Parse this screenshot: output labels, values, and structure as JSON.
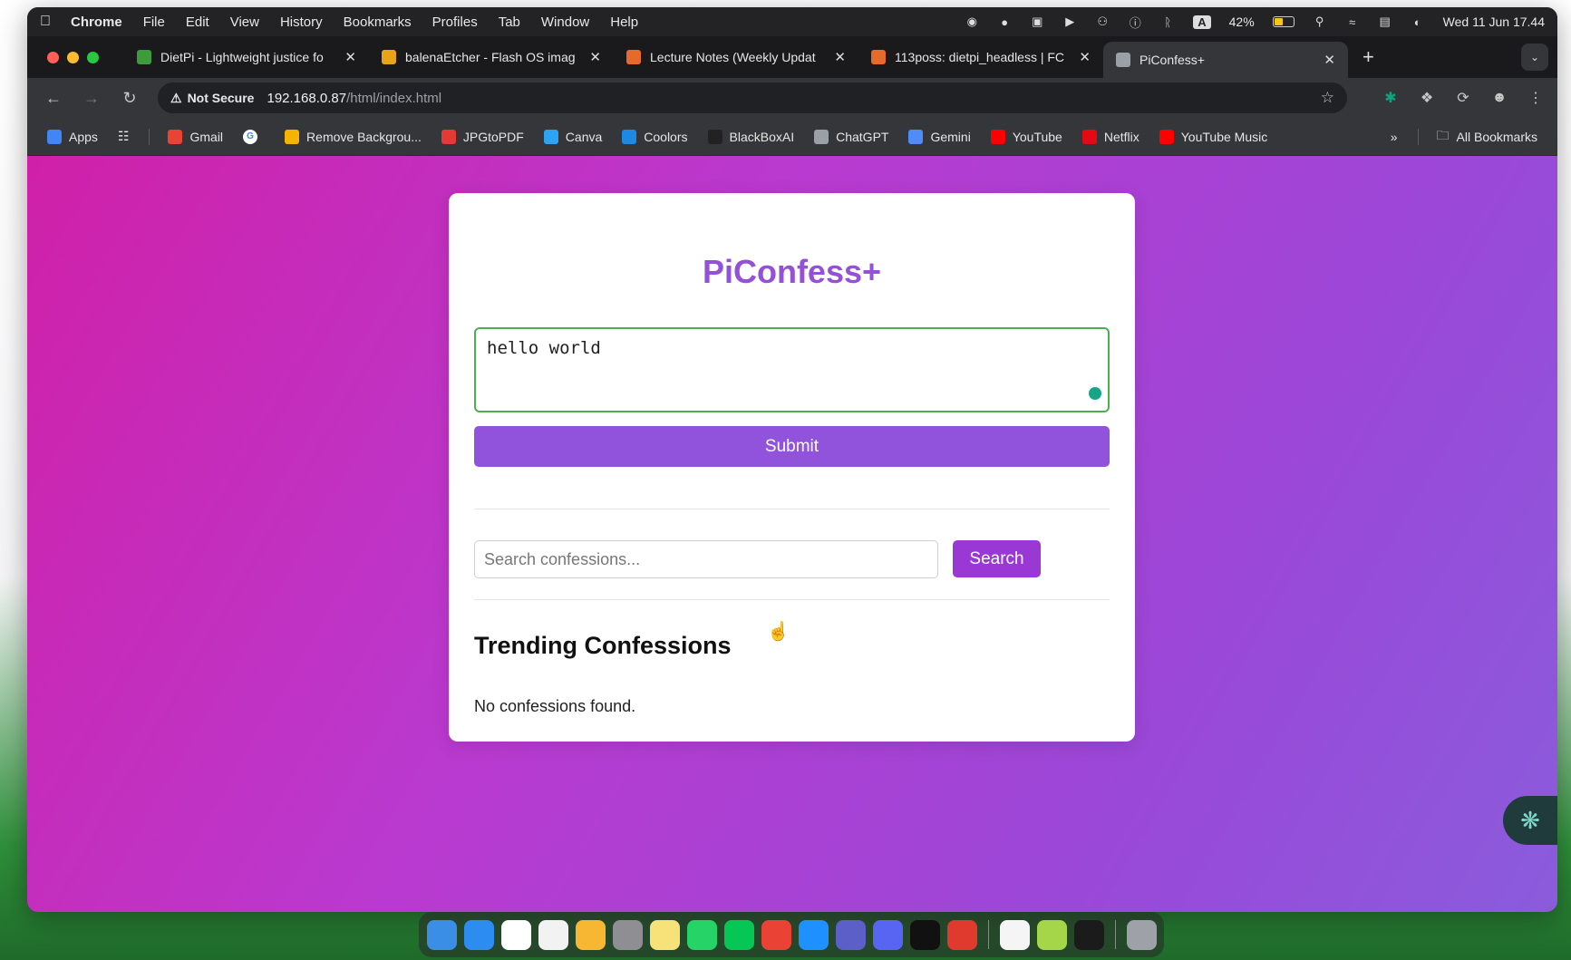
{
  "menubar": {
    "items": [
      "Chrome",
      "File",
      "Edit",
      "View",
      "History",
      "Bookmarks",
      "Profiles",
      "Tab",
      "Window",
      "Help"
    ],
    "status_a": "A",
    "battery_percent": "42%",
    "battery_level": 0.42,
    "clock": "Wed 11 Jun 17.44"
  },
  "tabs": [
    {
      "title": "DietPi - Lightweight justice fo",
      "favicon_color": "#3d9b3d"
    },
    {
      "title": "balenaEtcher - Flash OS imag",
      "favicon_color": "#e8a317"
    },
    {
      "title": "Lecture Notes (Weekly Updat",
      "favicon_color": "#e86a2b"
    },
    {
      "title": "113poss: dietpi_headless | FC",
      "favicon_color": "#e86a2b"
    },
    {
      "title": "PiConfess+",
      "favicon_color": "#9aa0a6",
      "active": true
    }
  ],
  "address": {
    "security": "Not Secure",
    "host": "192.168.0.87",
    "path": "/html/index.html"
  },
  "bookmarks": {
    "items": [
      {
        "label": "Apps",
        "color": "#4285f4"
      },
      {
        "label": "Gmail",
        "color": "#ea4335"
      },
      {
        "label": "Remove Backgrou...",
        "color": "#f4b400"
      },
      {
        "label": "JPGtoPDF",
        "color": "#e53935"
      },
      {
        "label": "Canva",
        "color": "#2ea3f2"
      },
      {
        "label": "Coolors",
        "color": "#1e88e5"
      },
      {
        "label": "BlackBoxAI",
        "color": "#222222"
      },
      {
        "label": "ChatGPT",
        "color": "#9aa0a6"
      },
      {
        "label": "Gemini",
        "color": "#4f8cf7"
      },
      {
        "label": "YouTube",
        "color": "#ff0000"
      },
      {
        "label": "Netflix",
        "color": "#e50914"
      },
      {
        "label": "YouTube Music",
        "color": "#ff0000"
      }
    ],
    "all_label": "All Bookmarks"
  },
  "app": {
    "title": "PiConfess+",
    "confession_value": "hello world",
    "submit_label": "Submit",
    "search_placeholder": "Search confessions...",
    "search_label": "Search",
    "trending_heading": "Trending Confessions",
    "empty_message": "No confessions found."
  },
  "colors": {
    "accent": "#9152dc",
    "title": "#9550d8",
    "search_button": "#9a38d6",
    "input_border_focus": "#4caf50"
  },
  "dock": {
    "items": [
      {
        "name": "finder",
        "color": "#3a8ee6"
      },
      {
        "name": "mail",
        "color": "#2d8cf0"
      },
      {
        "name": "calendar",
        "color": "#ffffff"
      },
      {
        "name": "clock",
        "color": "#f2f2f2"
      },
      {
        "name": "photos",
        "color": "#f7b733"
      },
      {
        "name": "system-settings",
        "color": "#8e8e93"
      },
      {
        "name": "notes",
        "color": "#f7e27a"
      },
      {
        "name": "whatsapp",
        "color": "#25d366"
      },
      {
        "name": "line",
        "color": "#06c755"
      },
      {
        "name": "chrome",
        "color": "#ea4335"
      },
      {
        "name": "safari",
        "color": "#1e90ff"
      },
      {
        "name": "teams",
        "color": "#5b5fc7"
      },
      {
        "name": "discord",
        "color": "#5865f2"
      },
      {
        "name": "capcut",
        "color": "#111111"
      },
      {
        "name": "acrobat",
        "color": "#e03a2f"
      },
      {
        "name": "textedit",
        "color": "#f5f5f5"
      },
      {
        "name": "balenaetcher",
        "color": "#a5d64a"
      },
      {
        "name": "terminal",
        "color": "#1b1b1b"
      },
      {
        "name": "trash",
        "color": "#9ea2a8"
      }
    ]
  }
}
